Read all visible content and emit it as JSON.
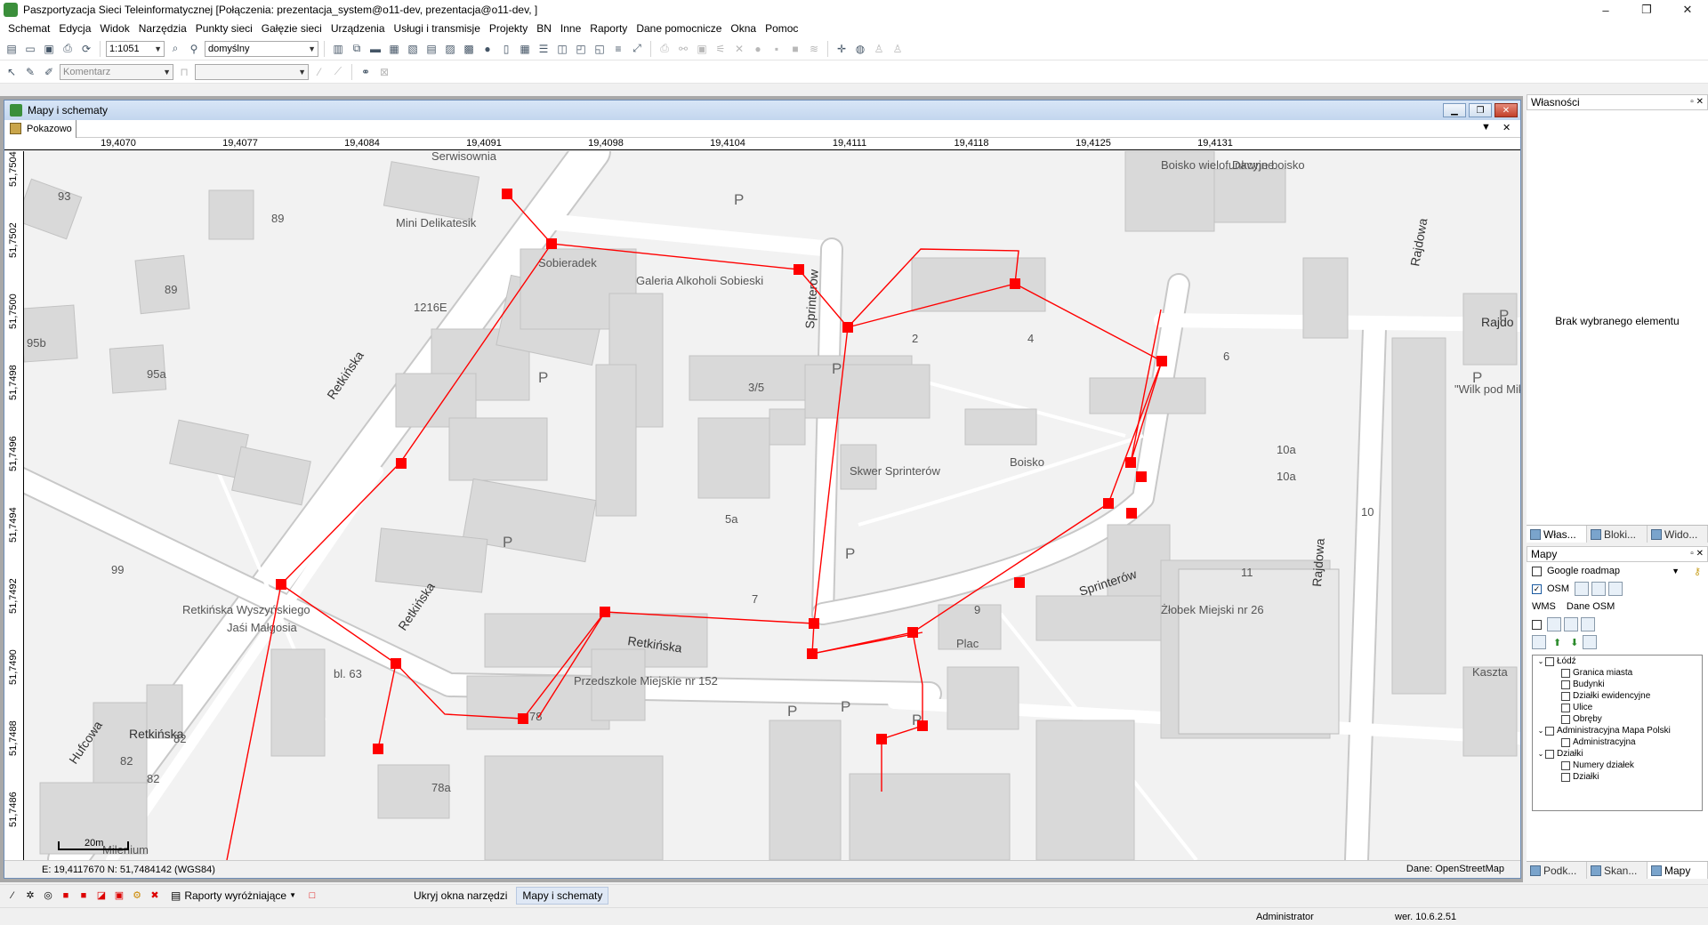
{
  "app": {
    "title": "Paszportyzacja Sieci Teleinformatycznej [Połączenia: prezentacja_system@o11-dev, prezentacja@o11-dev, ]",
    "minimize": "–",
    "maximize": "❐",
    "close": "✕"
  },
  "menu": [
    "Schemat",
    "Edycja",
    "Widok",
    "Narzędzia",
    "Punkty sieci",
    "Gałęzie sieci",
    "Urządzenia",
    "Usługi i transmisje",
    "Projekty",
    "BN",
    "Inne",
    "Raporty",
    "Dane pomocnicze",
    "Okna",
    "Pomoc"
  ],
  "toolbar": {
    "scale_value": "1:1051",
    "style_value": "domyślny",
    "comment_placeholder": "Komentarz"
  },
  "mapwindow": {
    "title": "Mapy i schematy",
    "tab_label": "Pokazowo",
    "x_ticks": [
      "19,4070",
      "19,4077",
      "19,4084",
      "19,4091",
      "19,4098",
      "19,4104",
      "19,4111",
      "19,4118",
      "19,4125",
      "19,4131"
    ],
    "y_ticks": [
      "51,7504",
      "51,7502",
      "51,7500",
      "51,7498",
      "51,7496",
      "51,7494",
      "51,7492",
      "51,7490",
      "51,7488",
      "51,7486"
    ],
    "coords": "E: 19,4117670  N: 51,7484142 (WGS84)",
    "data_source": "Dane: OpenStreetMap",
    "scale_label": "20m"
  },
  "map_labels": {
    "streets": [
      "Retkińska",
      "Retkińska",
      "Retkińska",
      "Hufcowa",
      "Sprinterów",
      "Sprinterów",
      "Rajdowa",
      "Rajdowa",
      "Retkińska",
      "Rajdo"
    ],
    "places": [
      "Mini Delikatesik",
      "Sobieradek",
      "Galeria Alkoholi Sobieski",
      "Skwer Sprinterów",
      "Boisko",
      "Żłobek Miejski nr 26",
      "Przedszkole Miejskie nr 152",
      "Retkińska Wyszyńskiego",
      "Jaśi Małgosia",
      "Boisko wielofunkcyjne",
      "Dawne boisko",
      "Plac",
      "\"Wilk pod Mikro",
      "Kaszta",
      "Serwisownia",
      "1216E",
      "Milenium"
    ],
    "numbers": [
      "93",
      "89",
      "89",
      "95b",
      "95a",
      "99",
      "3/5",
      "2",
      "4",
      "6",
      "7",
      "5a",
      "9",
      "10",
      "10a",
      "10a",
      "11",
      "bl. 63",
      "82",
      "82",
      "82",
      "78",
      "78a",
      "P",
      "P",
      "P",
      "P",
      "P",
      "P",
      "P",
      "P",
      "P",
      "P"
    ]
  },
  "properties": {
    "title": "Własności",
    "empty_message": "Brak wybranego elementu",
    "tabs": [
      "Włas...",
      "Bloki...",
      "Wido..."
    ]
  },
  "maps_panel": {
    "title": "Mapy",
    "basemap": "Google roadmap",
    "osm_label": "OSM",
    "subtabs": [
      "WMS",
      "Dane OSM"
    ],
    "tree": [
      {
        "label": "Łódź",
        "level": 0
      },
      {
        "label": "Granica miasta",
        "level": 1
      },
      {
        "label": "Budynki",
        "level": 1
      },
      {
        "label": "Działki ewidencyjne",
        "level": 1
      },
      {
        "label": "Ulice",
        "level": 1
      },
      {
        "label": "Obręby",
        "level": 1
      },
      {
        "label": "Administracyjna Mapa Polski",
        "level": 0
      },
      {
        "label": "Administracyjna",
        "level": 1
      },
      {
        "label": "Działki",
        "level": 0
      },
      {
        "label": "Numery działek",
        "level": 1
      },
      {
        "label": "Działki",
        "level": 1
      }
    ],
    "bottom_tabs": [
      "Podk...",
      "Skan...",
      "Mapy"
    ]
  },
  "bottombar": {
    "reports": "Raporty wyróżniające",
    "hide_tools": "Ukryj okna narzędzi",
    "maps_schemes": "Mapy i schematy"
  },
  "statusbar": {
    "user": "Administrator",
    "version": "wer. 10.6.2.51"
  },
  "colors": {
    "network": "#ff0000",
    "map_bg": "#f2f2f2",
    "building": "#d9d9d9",
    "road": "#ffffff"
  }
}
